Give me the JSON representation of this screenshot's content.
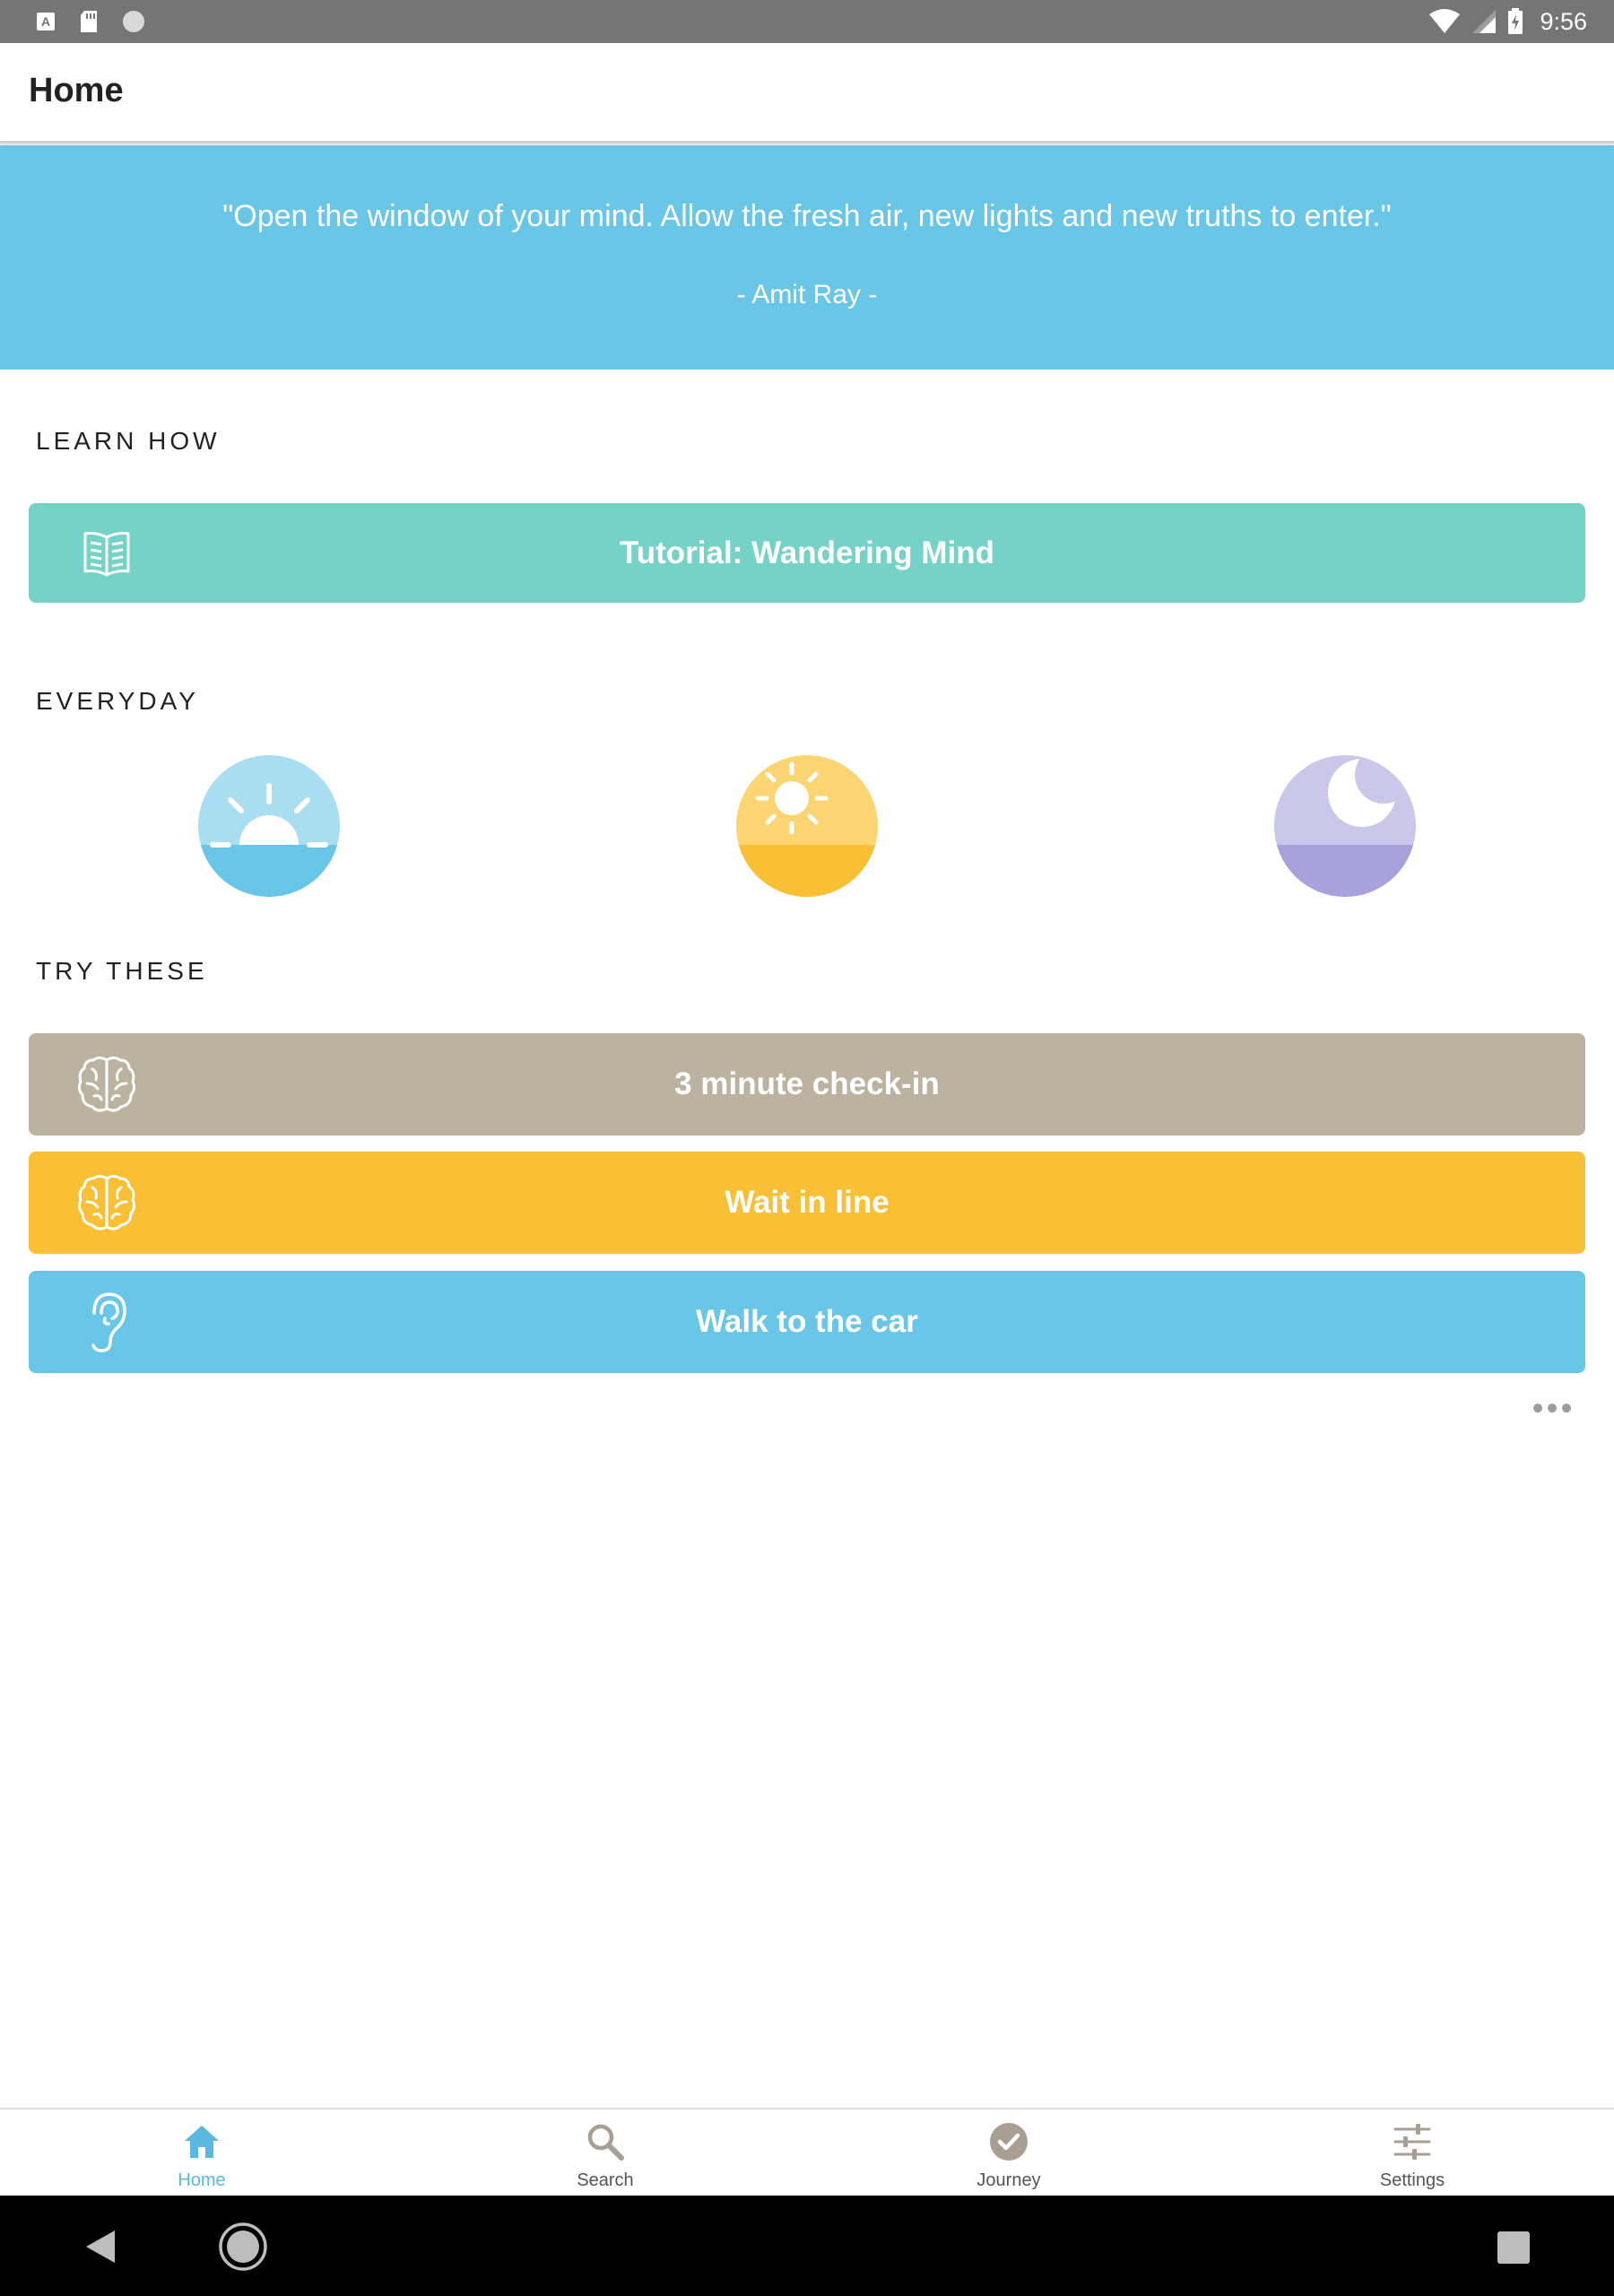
{
  "status_bar": {
    "time": "9:56",
    "left_icons": [
      "text-a-icon",
      "sd-card-icon",
      "circle-icon"
    ],
    "right_icons": [
      "wifi-icon",
      "cell-signal-icon",
      "battery-charging-icon"
    ]
  },
  "header": {
    "title": "Home"
  },
  "quote": {
    "text": "\"Open the window of your mind. Allow the fresh air, new lights and new truths to enter.\"",
    "author": "- Amit Ray -",
    "background": "#6ac6e6"
  },
  "learn_how": {
    "heading": "LEARN HOW",
    "button": {
      "label": "Tutorial: Wandering Mind",
      "icon": "open-book-icon",
      "color": "#74d3c6"
    }
  },
  "everyday": {
    "heading": "EVERYDAY",
    "items": [
      {
        "icon": "sunrise-icon",
        "top_color": "#a9def0",
        "bottom_color": "#6ac6e6"
      },
      {
        "icon": "sun-icon",
        "top_color": "#fcd471",
        "bottom_color": "#f9bf35"
      },
      {
        "icon": "moon-icon",
        "top_color": "#cac7ea",
        "bottom_color": "#a7a1dc"
      }
    ]
  },
  "try_these": {
    "heading": "TRY THESE",
    "items": [
      {
        "label": "3 minute check-in",
        "icon": "brain-icon",
        "color": "#bcb2a0"
      },
      {
        "label": "Wait in line",
        "icon": "brain-icon",
        "color": "#f9bf35"
      },
      {
        "label": "Walk to the car",
        "icon": "ear-icon",
        "color": "#6ac6e6"
      }
    ]
  },
  "more_icon": "more-horizontal-icon",
  "bottom_nav": {
    "active_color": "#5bb8e0",
    "inactive_color": "#a89f92",
    "items": [
      {
        "label": "Home",
        "icon": "home-icon",
        "active": true
      },
      {
        "label": "Search",
        "icon": "search-icon",
        "active": false
      },
      {
        "label": "Journey",
        "icon": "check-circle-icon",
        "active": false
      },
      {
        "label": "Settings",
        "icon": "sliders-icon",
        "active": false
      }
    ]
  },
  "system_nav": {
    "icons": [
      "back-icon",
      "home-circle-icon",
      "recents-icon"
    ]
  }
}
